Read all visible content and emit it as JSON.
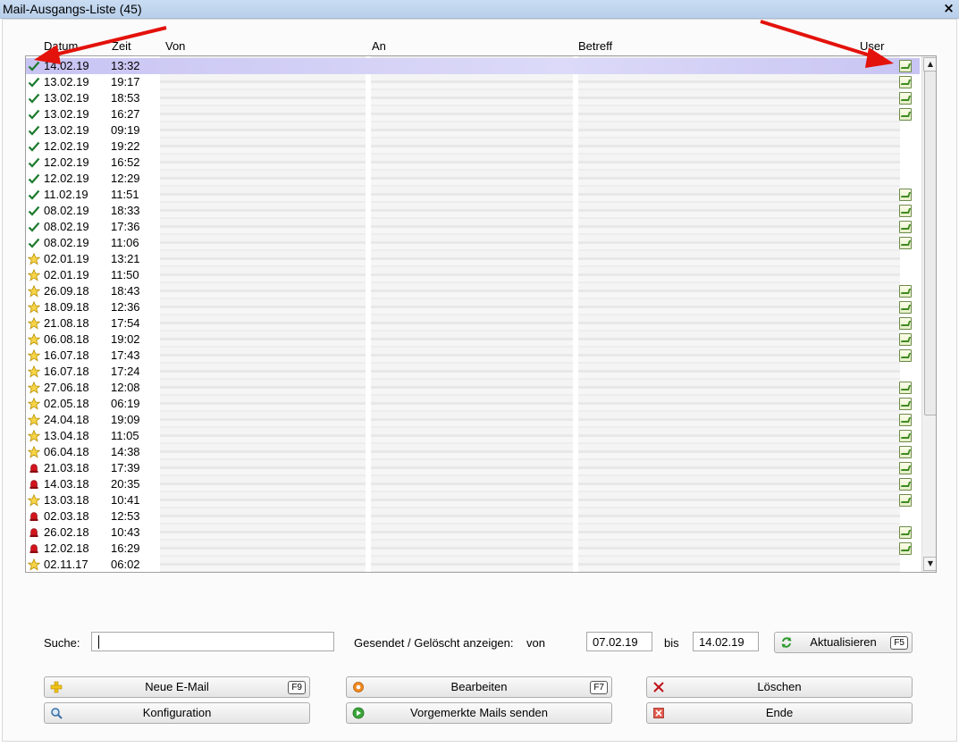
{
  "window": {
    "title": "Mail-Ausgangs-Liste (45)",
    "close_glyph": "×"
  },
  "columns": {
    "datum": "Datum",
    "zeit": "Zeit",
    "von": "Von",
    "an": "An",
    "betreff": "Betreff",
    "user": "User"
  },
  "rows": [
    {
      "status": "check-icon",
      "date": "14.02.19",
      "time": "13:32",
      "attachment": true,
      "selected": true
    },
    {
      "status": "check-icon",
      "date": "13.02.19",
      "time": "19:17",
      "attachment": true
    },
    {
      "status": "check-icon",
      "date": "13.02.19",
      "time": "18:53",
      "attachment": true
    },
    {
      "status": "check-icon",
      "date": "13.02.19",
      "time": "16:27",
      "attachment": true
    },
    {
      "status": "check-icon",
      "date": "13.02.19",
      "time": "09:19",
      "attachment": false
    },
    {
      "status": "check-icon",
      "date": "12.02.19",
      "time": "19:22",
      "attachment": false
    },
    {
      "status": "check-icon",
      "date": "12.02.19",
      "time": "16:52",
      "attachment": false
    },
    {
      "status": "check-icon",
      "date": "12.02.19",
      "time": "12:29",
      "attachment": false
    },
    {
      "status": "check-icon",
      "date": "11.02.19",
      "time": "11:51",
      "attachment": true
    },
    {
      "status": "check-icon",
      "date": "08.02.19",
      "time": "18:33",
      "attachment": true
    },
    {
      "status": "check-icon",
      "date": "08.02.19",
      "time": "17:36",
      "attachment": true
    },
    {
      "status": "check-icon",
      "date": "08.02.19",
      "time": "11:06",
      "attachment": true
    },
    {
      "status": "star-icon",
      "date": "02.01.19",
      "time": "13:21",
      "attachment": false
    },
    {
      "status": "star-icon",
      "date": "02.01.19",
      "time": "11:50",
      "attachment": false
    },
    {
      "status": "star-icon",
      "date": "26.09.18",
      "time": "18:43",
      "attachment": true
    },
    {
      "status": "star-icon",
      "date": "18.09.18",
      "time": "12:36",
      "attachment": true
    },
    {
      "status": "star-icon",
      "date": "21.08.18",
      "time": "17:54",
      "attachment": true
    },
    {
      "status": "star-icon",
      "date": "06.08.18",
      "time": "19:02",
      "attachment": true
    },
    {
      "status": "star-icon",
      "date": "16.07.18",
      "time": "17:43",
      "attachment": true
    },
    {
      "status": "star-icon",
      "date": "16.07.18",
      "time": "17:24",
      "attachment": false
    },
    {
      "status": "star-icon",
      "date": "27.06.18",
      "time": "12:08",
      "attachment": true
    },
    {
      "status": "star-icon",
      "date": "02.05.18",
      "time": "06:19",
      "attachment": true
    },
    {
      "status": "star-icon",
      "date": "24.04.18",
      "time": "19:09",
      "attachment": true
    },
    {
      "status": "star-icon",
      "date": "13.04.18",
      "time": "11:05",
      "attachment": true
    },
    {
      "status": "star-icon",
      "date": "06.04.18",
      "time": "14:38",
      "attachment": true
    },
    {
      "status": "bell-icon",
      "date": "21.03.18",
      "time": "17:39",
      "attachment": true
    },
    {
      "status": "bell-icon",
      "date": "14.03.18",
      "time": "20:35",
      "attachment": true
    },
    {
      "status": "star-icon",
      "date": "13.03.18",
      "time": "10:41",
      "attachment": true
    },
    {
      "status": "bell-icon",
      "date": "02.03.18",
      "time": "12:53",
      "attachment": false
    },
    {
      "status": "bell-icon",
      "date": "26.02.18",
      "time": "10:43",
      "attachment": true
    },
    {
      "status": "bell-icon",
      "date": "12.02.18",
      "time": "16:29",
      "attachment": true
    },
    {
      "status": "star-icon",
      "date": "02.11.17",
      "time": "06:02",
      "attachment": false
    }
  ],
  "search": {
    "label": "Suche:",
    "value": ""
  },
  "filter": {
    "label": "Gesendet / Gelöscht anzeigen:",
    "from_label": "von",
    "from_value": "07.02.19",
    "to_label": "bis",
    "to_value": "14.02.19"
  },
  "buttons": {
    "refresh": {
      "label": "Aktualisieren",
      "key": "F5",
      "icon": "refresh-icon"
    },
    "new_mail": {
      "label": "Neue E-Mail",
      "key": "F9",
      "icon": "plus-icon"
    },
    "edit": {
      "label": "Bearbeiten",
      "key": "F7",
      "icon": "edit-icon"
    },
    "delete": {
      "label": "Löschen",
      "icon": "x-icon"
    },
    "config": {
      "label": "Konfiguration",
      "icon": "magnifier-config-icon"
    },
    "send_marked": {
      "label": "Vorgemerkte Mails senden",
      "icon": "send-icon"
    },
    "end": {
      "label": "Ende",
      "icon": "exit-icon"
    }
  },
  "colors": {
    "selection": "#c8c4f3",
    "annotation_arrow": "#e3120b"
  }
}
